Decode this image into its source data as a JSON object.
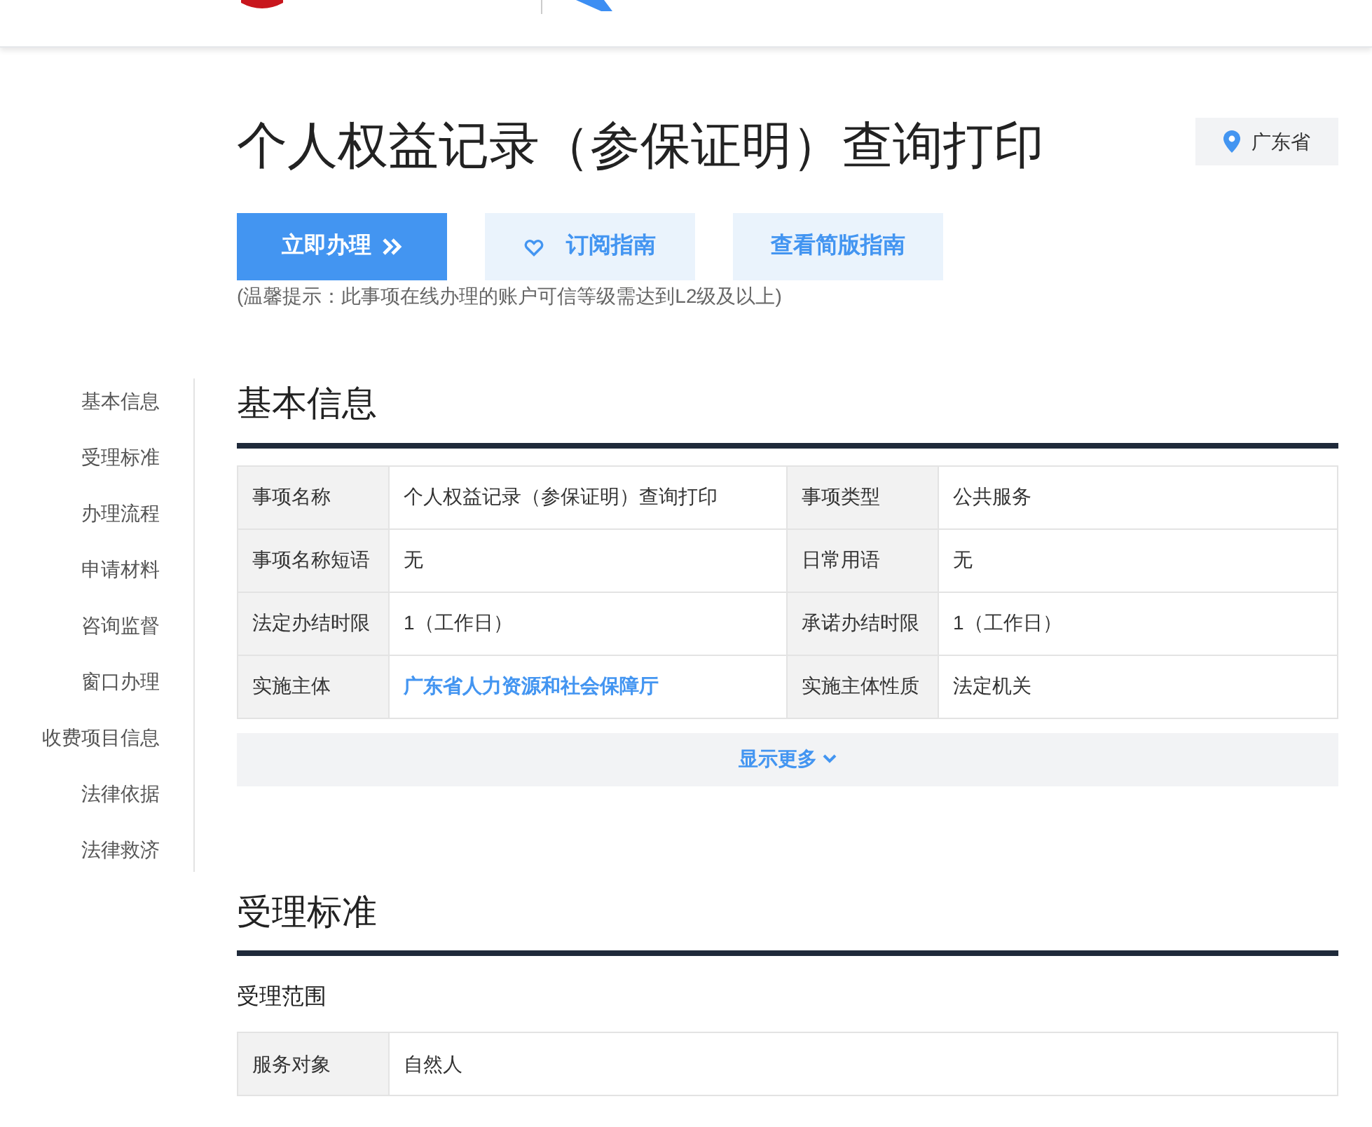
{
  "title": "个人权益记录（参保证明）查询打印",
  "region": "广东省",
  "actions": [
    {
      "kind": "primary",
      "label": "立即办理"
    },
    {
      "kind": "subscribe",
      "label": "订阅指南"
    },
    {
      "kind": "plain",
      "label": "查看简版指南"
    }
  ],
  "tip": "(温馨提示：此事项在线办理的账户可信等级需达到L2级及以上)",
  "side_nav": [
    "基本信息",
    "受理标准",
    "办理流程",
    "申请材料",
    "咨询监督",
    "窗口办理",
    "收费项目信息",
    "法律依据",
    "法律救济"
  ],
  "basic": {
    "heading": "基本信息",
    "rows": [
      [
        {
          "label": "事项名称",
          "value": "个人权益记录（参保证明）查询打印"
        },
        {
          "label": "事项类型",
          "value": "公共服务"
        }
      ],
      [
        {
          "label": "事项名称短语",
          "value": "无"
        },
        {
          "label": "日常用语",
          "value": "无"
        }
      ],
      [
        {
          "label": "法定办结时限",
          "value": "1（工作日）"
        },
        {
          "label": "承诺办结时限",
          "value": "1（工作日）"
        }
      ],
      [
        {
          "label": "实施主体",
          "value": "广东省人力资源和社会保障厅",
          "link": true
        },
        {
          "label": "实施主体性质",
          "value": "法定机关"
        }
      ]
    ],
    "more": "显示更多"
  },
  "acceptance": {
    "heading": "受理标准",
    "subheading": "受理范围",
    "rows": [
      {
        "label": "服务对象",
        "value": "自然人"
      }
    ]
  }
}
